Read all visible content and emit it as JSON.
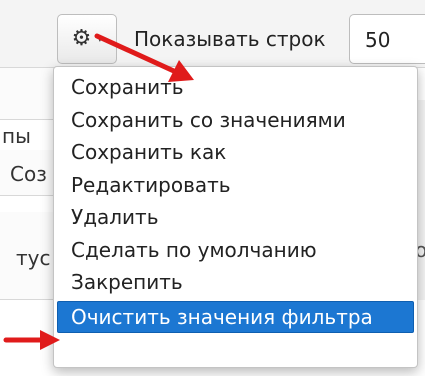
{
  "toolbar": {
    "rows_label": "Показывать строк",
    "rows_value": "50"
  },
  "background": {
    "fragment_1": "пы",
    "fragment_2": "Соз",
    "fragment_3": "тус",
    "fragment_4": "о"
  },
  "menu": {
    "items": [
      {
        "label": "Сохранить"
      },
      {
        "label": "Сохранить со значениями"
      },
      {
        "label": "Сохранить как"
      },
      {
        "label": "Редактировать"
      },
      {
        "label": "Удалить"
      },
      {
        "label": "Сделать по умолчанию"
      },
      {
        "label": "Закрепить"
      },
      {
        "label": "Очистить значения фильтра",
        "highlighted": true
      }
    ]
  },
  "icons": {
    "gear": "gear-icon",
    "caret": "caret-down-icon"
  },
  "colors": {
    "highlight": "#1c77d2",
    "arrow": "#e01b1b"
  }
}
